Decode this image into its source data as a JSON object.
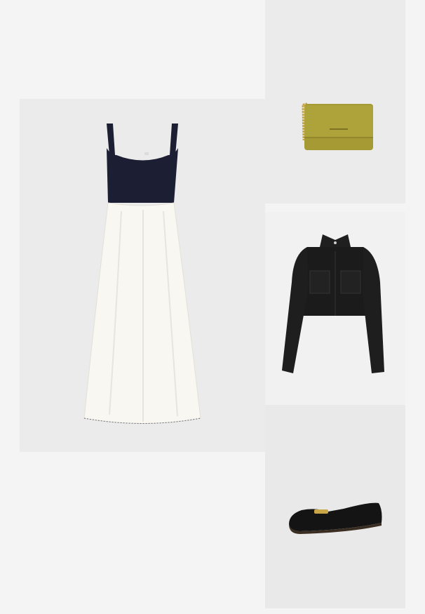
{
  "products": [
    {
      "name": "dress",
      "icon": "dress-image",
      "bodice_color": "#1c1f33",
      "skirt_color": "#f8f7f2"
    },
    {
      "name": "bag",
      "icon": "crossbody-bag-image",
      "color": "#a59a34",
      "chain_color": "#c9a646"
    },
    {
      "name": "jacket",
      "icon": "cropped-jacket-image",
      "color": "#1b1b1b"
    },
    {
      "name": "loafer",
      "icon": "loafer-image",
      "color": "#141414",
      "hardware_color": "#c9a646"
    }
  ]
}
